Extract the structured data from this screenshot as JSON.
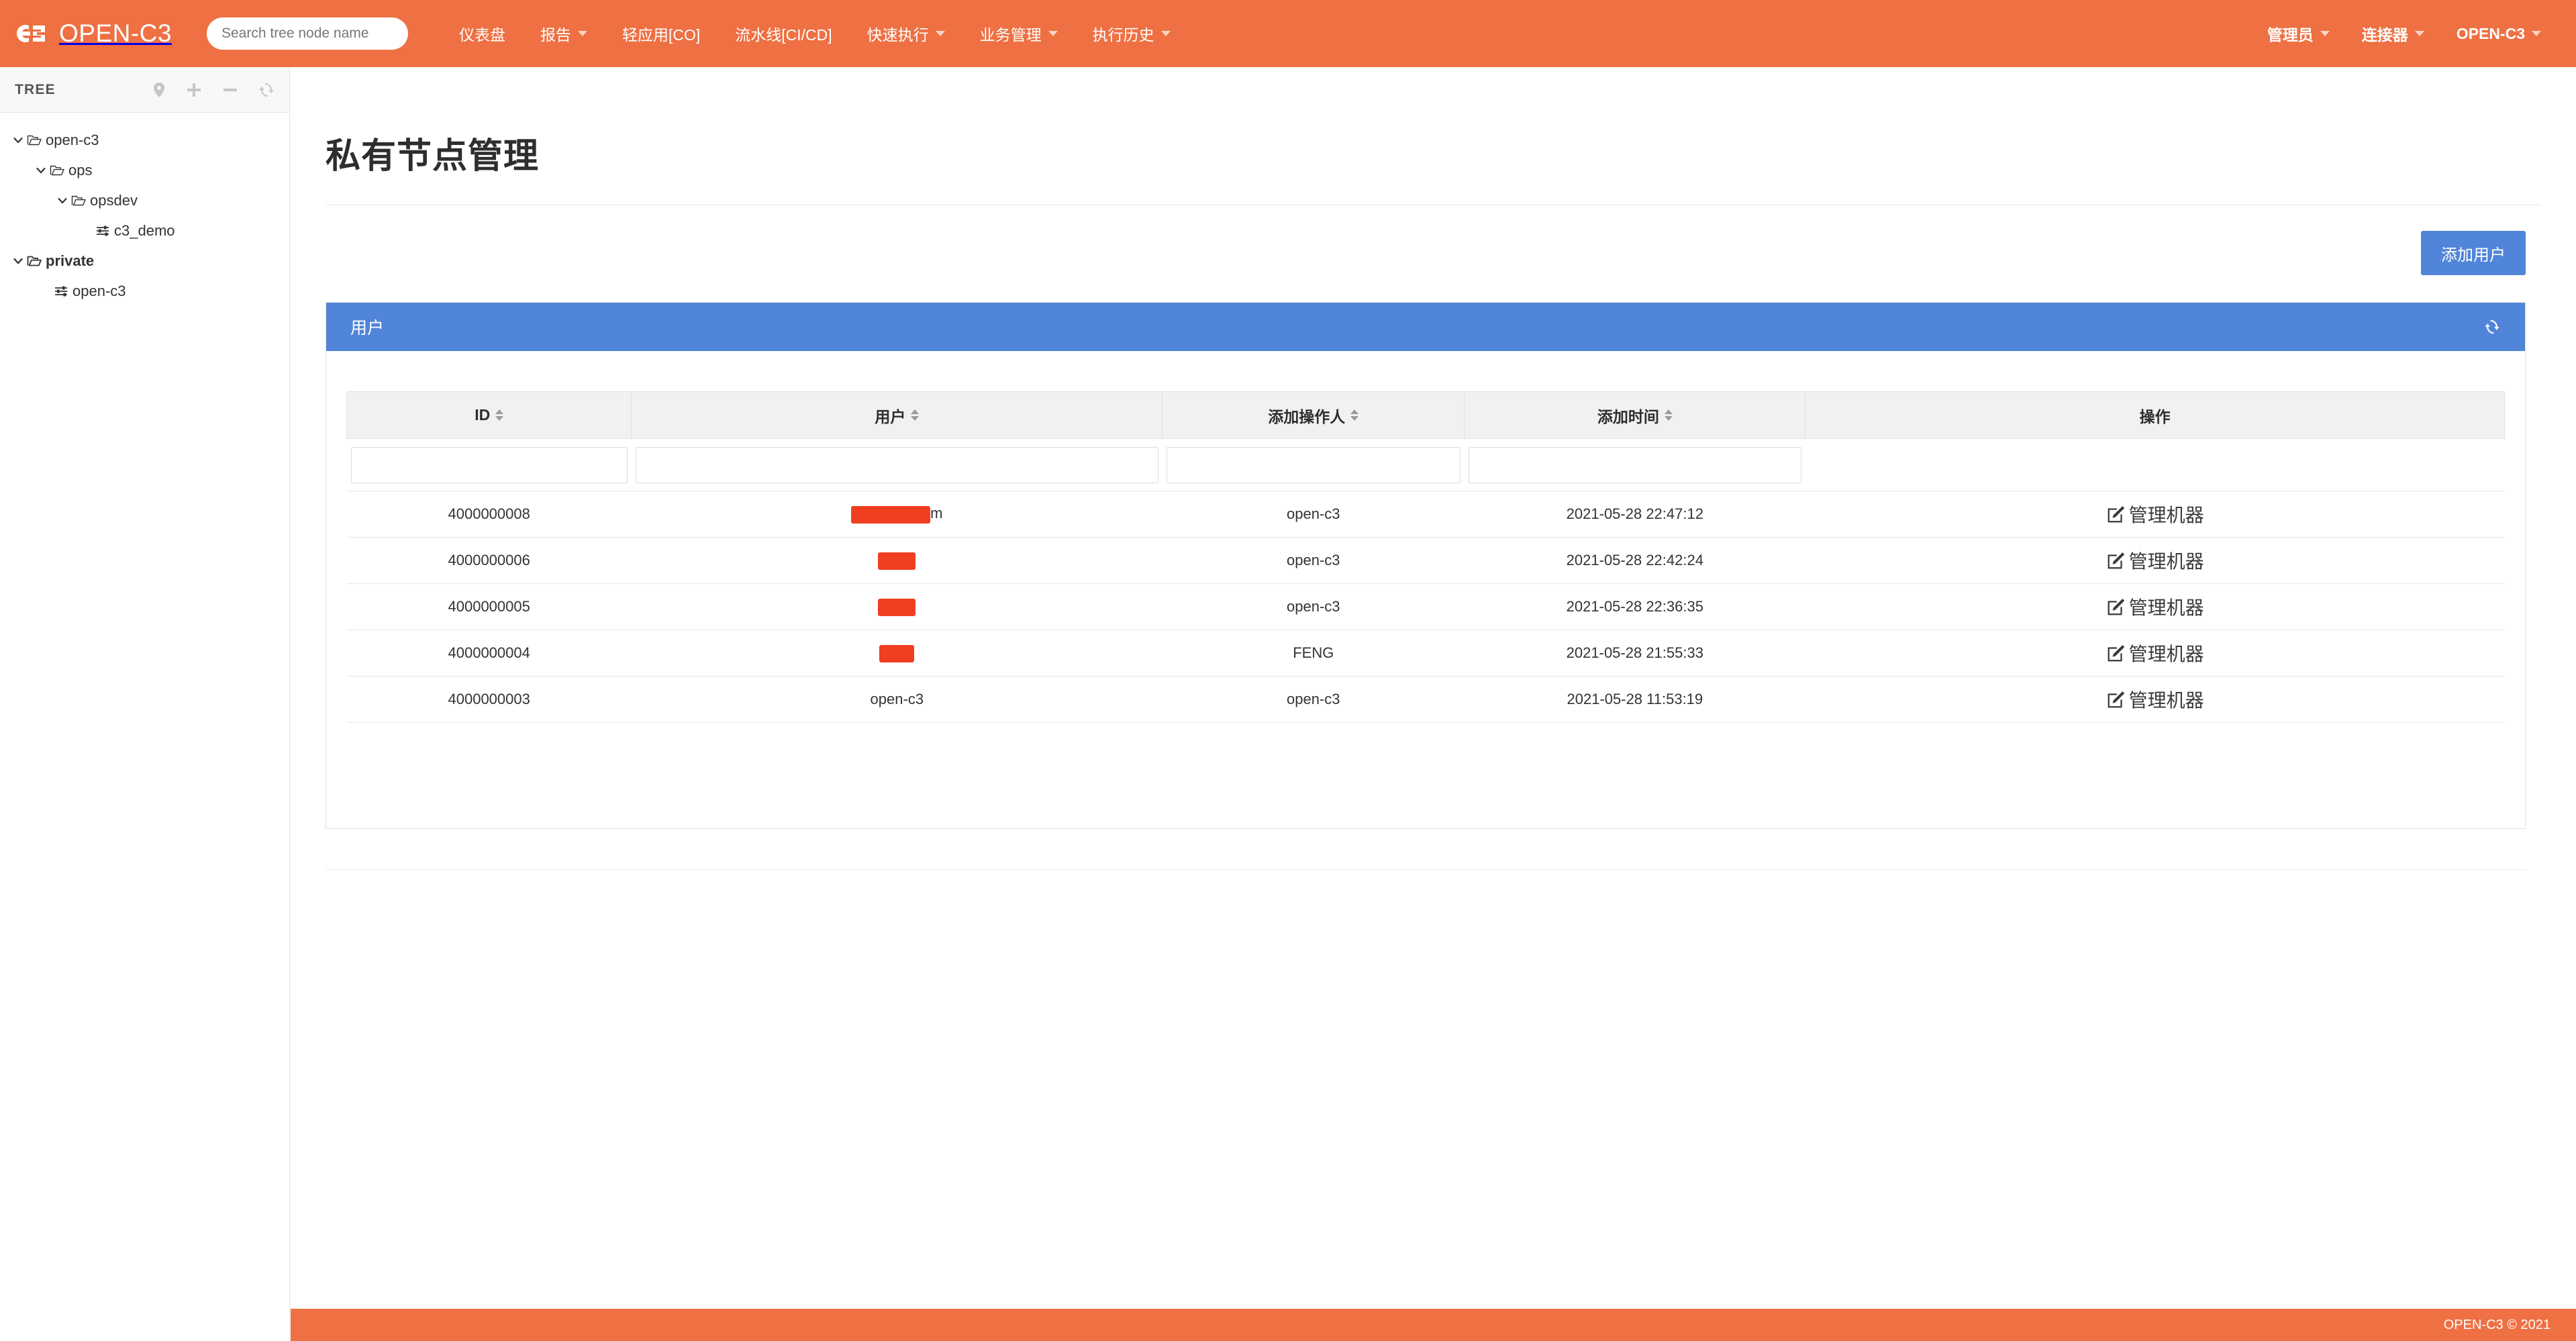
{
  "header": {
    "brand": "OPEN-C3",
    "logo_icon": "c3-logo-icon",
    "search": {
      "placeholder": "Search tree node name",
      "value": ""
    },
    "nav": [
      {
        "label": "仪表盘",
        "has_caret": false
      },
      {
        "label": "报告",
        "has_caret": true
      },
      {
        "label": "轻应用[CO]",
        "has_caret": false
      },
      {
        "label": "流水线[CI/CD]",
        "has_caret": false
      },
      {
        "label": "快速执行",
        "has_caret": true
      },
      {
        "label": "业务管理",
        "has_caret": true
      },
      {
        "label": "执行历史",
        "has_caret": true
      }
    ],
    "nav_right": [
      {
        "label": "管理员",
        "has_caret": true
      },
      {
        "label": "连接器",
        "has_caret": true
      },
      {
        "label": "OPEN-C3",
        "has_caret": true
      }
    ]
  },
  "sidebar": {
    "title": "TREE",
    "tools": [
      {
        "name": "locate-pin-icon"
      },
      {
        "name": "plus-icon"
      },
      {
        "name": "minus-icon"
      },
      {
        "name": "refresh-icon"
      }
    ],
    "tree": [
      {
        "label": "open-c3",
        "depth": 0,
        "chevron": "down",
        "icon": "folder-open-icon",
        "bold": false
      },
      {
        "label": "ops",
        "depth": 1,
        "chevron": "down",
        "icon": "folder-open-icon",
        "bold": false
      },
      {
        "label": "opsdev",
        "depth": 2,
        "chevron": "down",
        "icon": "folder-open-icon",
        "bold": false
      },
      {
        "label": "c3_demo",
        "depth": 3,
        "chevron": "none",
        "icon": "sliders-icon",
        "bold": false
      },
      {
        "label": "private",
        "depth": 0,
        "chevron": "down",
        "icon": "folder-open-icon",
        "bold": true
      },
      {
        "label": "open-c3",
        "depth": 1,
        "chevron": "none",
        "icon": "sliders-icon",
        "bold": false
      }
    ]
  },
  "main": {
    "page_title": "私有节点管理",
    "add_user_label": "添加用户",
    "panel": {
      "title": "用户",
      "refresh_icon": "refresh-icon"
    },
    "table": {
      "columns": [
        {
          "label": "ID",
          "sortable": true
        },
        {
          "label": "用户",
          "sortable": true
        },
        {
          "label": "添加操作人",
          "sortable": true
        },
        {
          "label": "添加时间",
          "sortable": true
        },
        {
          "label": "操作",
          "sortable": false
        }
      ],
      "filters": [
        {
          "value": "",
          "placeholder": ""
        },
        {
          "value": "",
          "placeholder": ""
        },
        {
          "value": "",
          "placeholder": ""
        },
        {
          "value": "",
          "placeholder": ""
        }
      ],
      "rows": [
        {
          "id": "4000000008",
          "user": "",
          "user_redacted": true,
          "user_redact_width": 118,
          "user_suffix": "m",
          "operator": "open-c3",
          "time": "2021-05-28 22:47:12",
          "action": "管理机器"
        },
        {
          "id": "4000000006",
          "user": "",
          "user_redacted": true,
          "user_redact_width": 56,
          "user_suffix": "",
          "operator": "open-c3",
          "time": "2021-05-28 22:42:24",
          "action": "管理机器"
        },
        {
          "id": "4000000005",
          "user": "",
          "user_redacted": true,
          "user_redact_width": 56,
          "user_suffix": "",
          "operator": "open-c3",
          "time": "2021-05-28 22:36:35",
          "action": "管理机器"
        },
        {
          "id": "4000000004",
          "user": "",
          "user_redacted": true,
          "user_redact_width": 52,
          "user_suffix": "",
          "operator": "FENG",
          "time": "2021-05-28 21:55:33",
          "action": "管理机器"
        },
        {
          "id": "4000000003",
          "user": "open-c3",
          "user_redacted": false,
          "user_redact_width": 0,
          "user_suffix": "",
          "operator": "open-c3",
          "time": "2021-05-28 11:53:19",
          "action": "管理机器"
        }
      ]
    }
  },
  "footer": {
    "copyright": "OPEN-C3 © 2021"
  },
  "colors": {
    "brand_orange": "#ee7043",
    "panel_blue": "#5085d9",
    "redaction_red": "#f03e20"
  }
}
